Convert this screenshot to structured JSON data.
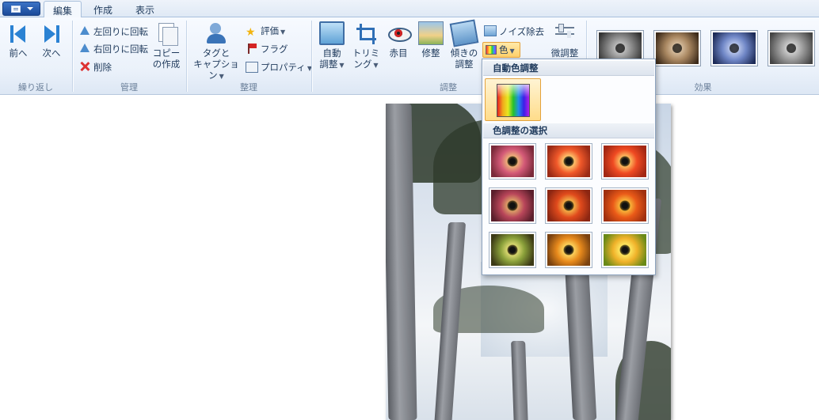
{
  "tabs": {
    "app_menu": "app-menu",
    "items": [
      "編集",
      "作成",
      "表示"
    ]
  },
  "ribbon": {
    "navigation": {
      "prev": "前へ",
      "next": "次へ",
      "group": "繰り返し"
    },
    "manage": {
      "rotate_left": "左回りに回転",
      "rotate_right": "右回りに回転",
      "delete": "削除",
      "copy_line1": "コピー",
      "copy_line2": "の作成",
      "group": "管理"
    },
    "organize": {
      "tag_line1": "タグと",
      "tag_line2": "キャプション",
      "rating": "評価",
      "flag": "フラグ",
      "properties": "プロパティ",
      "group": "整理"
    },
    "adjust": {
      "auto_line1": "自動",
      "auto_line2": "調整",
      "trim_line1": "トリミ",
      "trim_line2": "ング",
      "redeye": "赤目",
      "retouch": "修整",
      "tilt_line1": "傾きの",
      "tilt_line2": "調整",
      "noise": "ノイズ除去",
      "color": "色",
      "fine_tune": "微調整",
      "group": "調整"
    },
    "effects": {
      "group": "効果"
    }
  },
  "color_menu": {
    "auto_header": "自動色調整",
    "select_header": "色調整の選択"
  },
  "colors": {
    "accent_hover": "#ffd06a",
    "ribbon_text": "#1e395b",
    "group_label": "#6a7f99"
  }
}
